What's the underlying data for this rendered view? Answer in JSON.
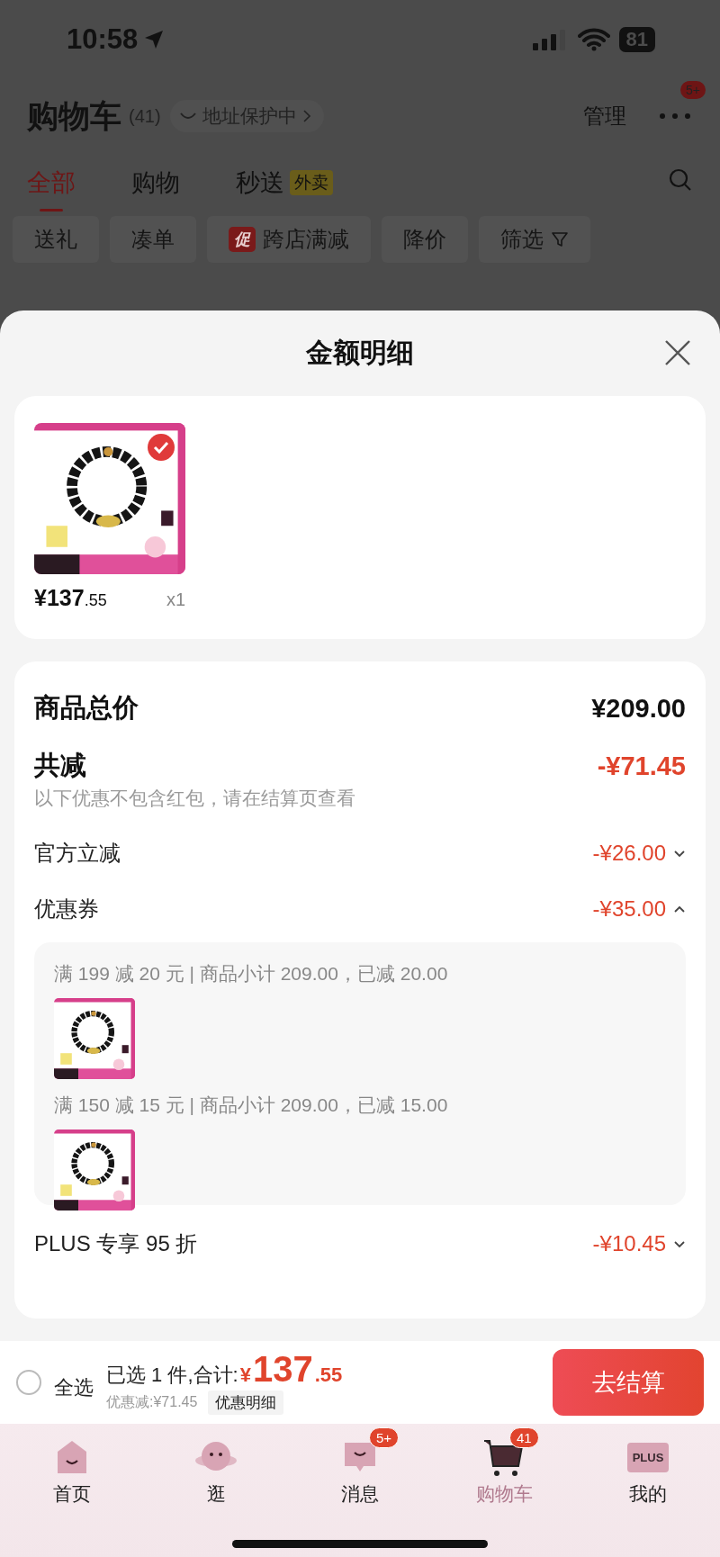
{
  "status_bar": {
    "time": "10:58",
    "battery": "81"
  },
  "header": {
    "title": "购物车",
    "count": "(41)",
    "address": "地址保护中",
    "manage": "管理",
    "more_badge": "5+"
  },
  "tabs": [
    {
      "label": "全部",
      "selected": true
    },
    {
      "label": "购物",
      "selected": false
    },
    {
      "label": "秒送",
      "tag": "外卖",
      "selected": false
    }
  ],
  "filters": [
    {
      "label": "送礼",
      "kind": "chip"
    },
    {
      "label": "凑单",
      "kind": "chip"
    },
    {
      "label": "跨店满减",
      "tag": "促",
      "kind": "promo"
    },
    {
      "label": "降价",
      "kind": "chip"
    },
    {
      "label": "筛选",
      "kind": "filter"
    }
  ],
  "sheet": {
    "title": "金额明细",
    "products": [
      {
        "price": "¥137",
        "price_decimal": ".55",
        "quantity": "x1",
        "selected": true
      }
    ],
    "summary": {
      "total_label": "商品总价",
      "total_value": "¥209.00",
      "discount_label": "共减",
      "discount_value": "-¥71.45",
      "note": "以下优惠不包含红包，请在结算页查看",
      "items": [
        {
          "label": "官方立减",
          "value": "-¥26.00",
          "expanded": false
        },
        {
          "label": "优惠券",
          "value": "-¥35.00",
          "expanded": true,
          "coupons": [
            {
              "text": "满 199 减 20 元 | 商品小计 209.00，已减 20.00",
              "kind": "picture"
            },
            {
              "text": "满 150 减 15 元 | 商品小计 209.00，已减 15.00",
              "kind": "picture"
            }
          ]
        },
        {
          "label": "PLUS 专享 95 折",
          "value": "-¥10.45",
          "expanded": false
        }
      ]
    }
  },
  "checkout_bar": {
    "select_all": {
      "label": "全选",
      "checked": false
    },
    "summary": "已选 1 件,合计:",
    "currency": "¥",
    "amount": "137",
    "amount_decimal": ".55",
    "discount": "优惠减:¥71.45",
    "detail_button": "优惠明细",
    "checkout_button": "去结算"
  },
  "tab_bar": [
    {
      "label": "首页",
      "kind": "home",
      "selected": false
    },
    {
      "label": "逛",
      "kind": "planet",
      "selected": false
    },
    {
      "label": "消息",
      "kind": "message",
      "badge": "5+",
      "selected": false
    },
    {
      "label": "购物车",
      "kind": "cart",
      "badge": "41",
      "selected": true
    },
    {
      "label": "我的",
      "kind": "plus",
      "icon_text": "PLUS",
      "selected": false
    }
  ]
}
